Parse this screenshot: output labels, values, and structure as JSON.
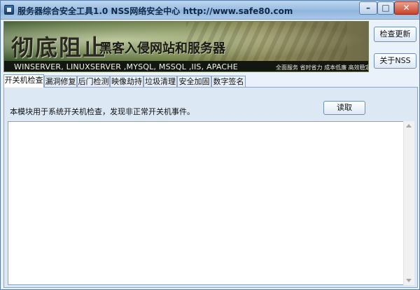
{
  "window": {
    "title": "服务器综合安全工具1.0  NSS网络安全中心 http://www.safe80.com",
    "controls": {
      "minimize": "–",
      "maximize": "□",
      "close": "✕"
    }
  },
  "banner": {
    "main_text": "彻底阻止",
    "sub_text": "黑客入侵网站和服务器",
    "tech_text": "WINSERVER, LINUXSERVER ,MYSQL, MSSQL ,IIS, APACHE",
    "slogan": "全面服务 省时省力 成本低廉 高效稳定"
  },
  "side_buttons": {
    "check_update": "检查更新",
    "about": "关于NSS"
  },
  "tabs": [
    {
      "label": "开关机检查",
      "active": true
    },
    {
      "label": "漏洞修复"
    },
    {
      "label": "后门检测"
    },
    {
      "label": "映像劫持"
    },
    {
      "label": "垃圾清理"
    },
    {
      "label": "安全加固"
    },
    {
      "label": "数字签名"
    }
  ],
  "panel": {
    "description": "本模块用于系统开关机检查，发现非正常开关机事件。",
    "read_button": "读取",
    "output_text": ""
  }
}
